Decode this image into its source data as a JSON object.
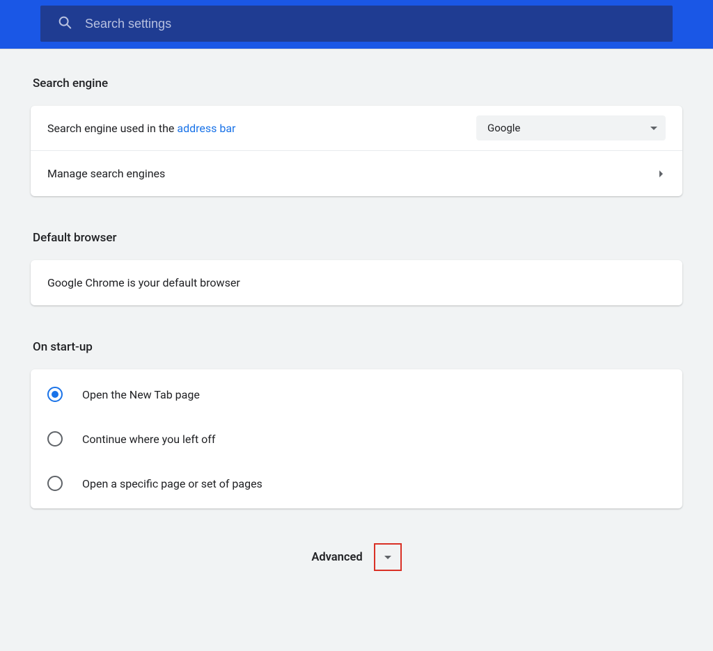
{
  "header": {
    "search_placeholder": "Search settings"
  },
  "sections": {
    "search_engine": {
      "title": "Search engine",
      "row1_prefix": "Search engine used in the ",
      "row1_link": "address bar",
      "selected_engine": "Google",
      "manage_label": "Manage search engines"
    },
    "default_browser": {
      "title": "Default browser",
      "status": "Google Chrome is your default browser"
    },
    "startup": {
      "title": "On start-up",
      "options": [
        "Open the New Tab page",
        "Continue where you left off",
        "Open a specific page or set of pages"
      ],
      "selected_index": 0
    }
  },
  "advanced": {
    "label": "Advanced"
  }
}
